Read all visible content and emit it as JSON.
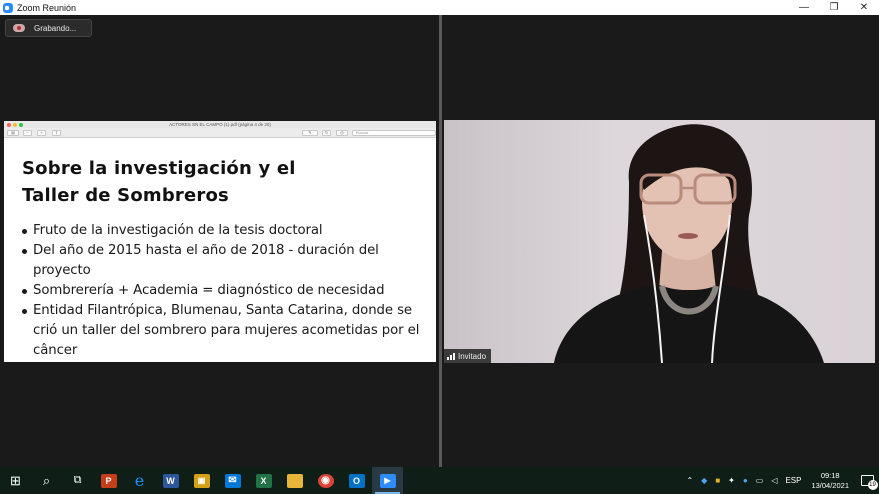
{
  "window": {
    "title": "Zoom Reunión",
    "minimize": "—",
    "maximize": "❐",
    "close": "✕"
  },
  "recording": {
    "label": "Grabando..."
  },
  "shared_screen": {
    "pdf_title": "ACTORES SN EL CAMPO (1).pdf (página 4 de 20)",
    "search_placeholder": "Buscar",
    "slide": {
      "title_line1": "Sobre la investigación y el",
      "title_line2": "Taller de Sombreros",
      "bullets": [
        "Fruto de la investigación de la tesis doctoral",
        "Del año de 2015 hasta el año de 2018 - duración del proyecto",
        "Sombrerería + Academia = diagnóstico de necesidad",
        "Entidad Filantrópica, Blumenau, Santa Catarina, donde se crió un taller del sombrero para mujeres acometidas por el câncer"
      ]
    }
  },
  "participant": {
    "name": "Invitado"
  },
  "taskbar": {
    "apps": [
      {
        "name": "windows-start",
        "glyph": "⊞"
      },
      {
        "name": "search",
        "glyph": "⌕"
      },
      {
        "name": "task-view",
        "glyph": "⧉"
      },
      {
        "name": "powerpoint",
        "glyph": "P",
        "color": "#c43e1c"
      },
      {
        "name": "internet-explorer",
        "glyph": "e",
        "color": "#1e90ff"
      },
      {
        "name": "word",
        "glyph": "W",
        "color": "#2b579a"
      },
      {
        "name": "lock-app",
        "glyph": "🔒",
        "color": "#d4a017"
      },
      {
        "name": "mail",
        "glyph": "✉",
        "color": "#0078d7"
      },
      {
        "name": "excel",
        "glyph": "X",
        "color": "#217346"
      },
      {
        "name": "file-explorer",
        "glyph": "▬",
        "color": "#e8b43a"
      },
      {
        "name": "chrome",
        "glyph": "◉",
        "color": "#db4437"
      },
      {
        "name": "outlook",
        "glyph": "O",
        "color": "#0072c6"
      },
      {
        "name": "zoom",
        "glyph": "▶",
        "color": "#2d8cff"
      }
    ],
    "tray": {
      "language": "ESP",
      "time": "09:18",
      "date": "13/04/2021",
      "notifications": "19"
    }
  }
}
